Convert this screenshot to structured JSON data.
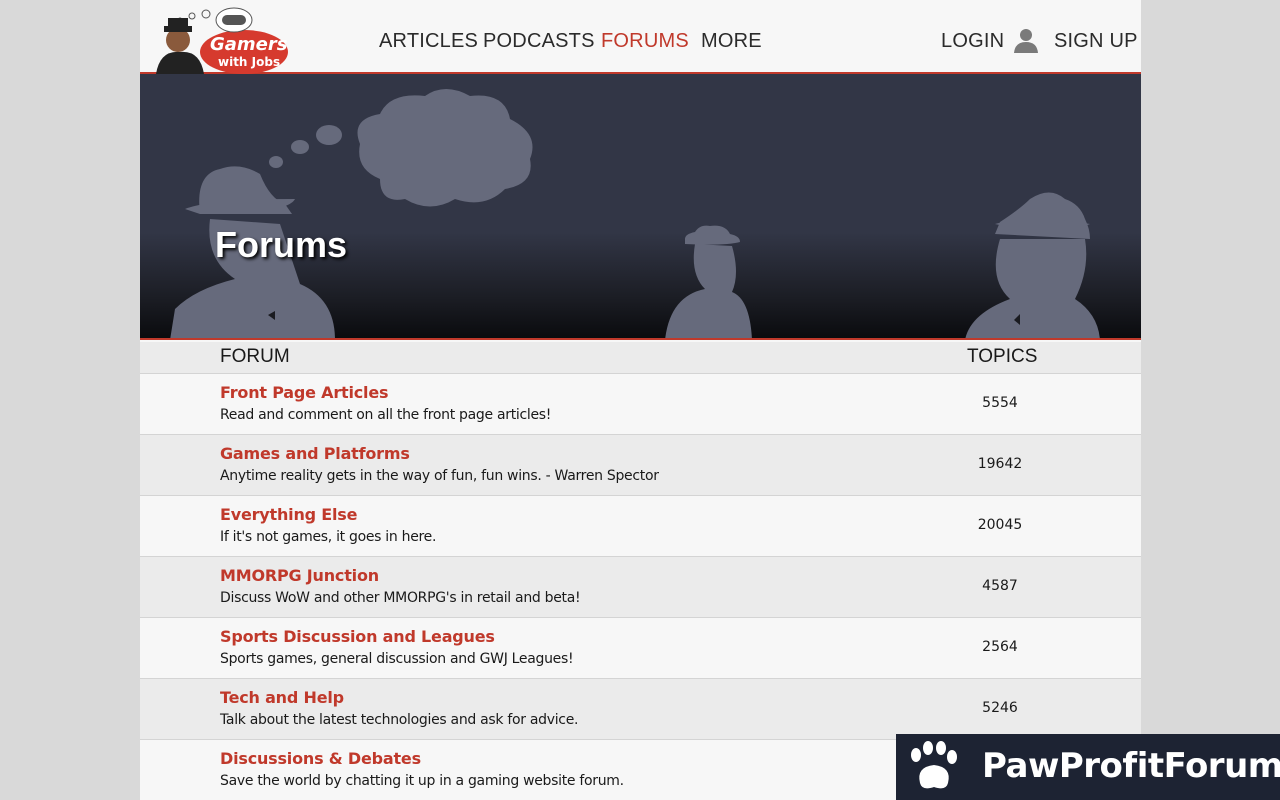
{
  "header": {
    "logo_text_line1": "Gamers",
    "logo_text_line2": "with Jobs",
    "nav": [
      {
        "label": "ARTICLES",
        "active": false
      },
      {
        "label": "PODCASTS",
        "active": false
      },
      {
        "label": "FORUMS",
        "active": true
      },
      {
        "label": "MORE",
        "active": false
      }
    ],
    "login_label": "LOGIN",
    "signup_label": "SIGN UP",
    "user_icon": "user-silhouette-icon"
  },
  "hero": {
    "title": "Forums"
  },
  "table": {
    "col_forum": "FORUM",
    "col_topics": "TOPICS",
    "rows": [
      {
        "title": "Front Page Articles",
        "description": "Read and comment on all the front page articles!",
        "topics": "5554"
      },
      {
        "title": "Games and Platforms",
        "description": "Anytime reality gets in the way of fun, fun wins. - Warren Spector",
        "topics": "19642"
      },
      {
        "title": "Everything Else",
        "description": "If it's not games, it goes in here.",
        "topics": "20045"
      },
      {
        "title": "MMORPG Junction",
        "description": "Discuss WoW and other MMORPG's in retail and beta!",
        "topics": "4587"
      },
      {
        "title": "Sports Discussion and Leagues",
        "description": "Sports games, general discussion and GWJ Leagues!",
        "topics": "2564"
      },
      {
        "title": "Tech and Help",
        "description": "Talk about the latest technologies and ask for advice.",
        "topics": "5246"
      },
      {
        "title": "Discussions & Debates",
        "description": "Save the world by chatting it up in a gaming website forum.",
        "topics": ""
      }
    ]
  },
  "watermark": {
    "text": "PawProfitForum",
    "icon": "paw-icon"
  },
  "colors": {
    "accent": "#c0392b",
    "hero_bg": "#323646",
    "badge_bg": "#1d2333"
  }
}
